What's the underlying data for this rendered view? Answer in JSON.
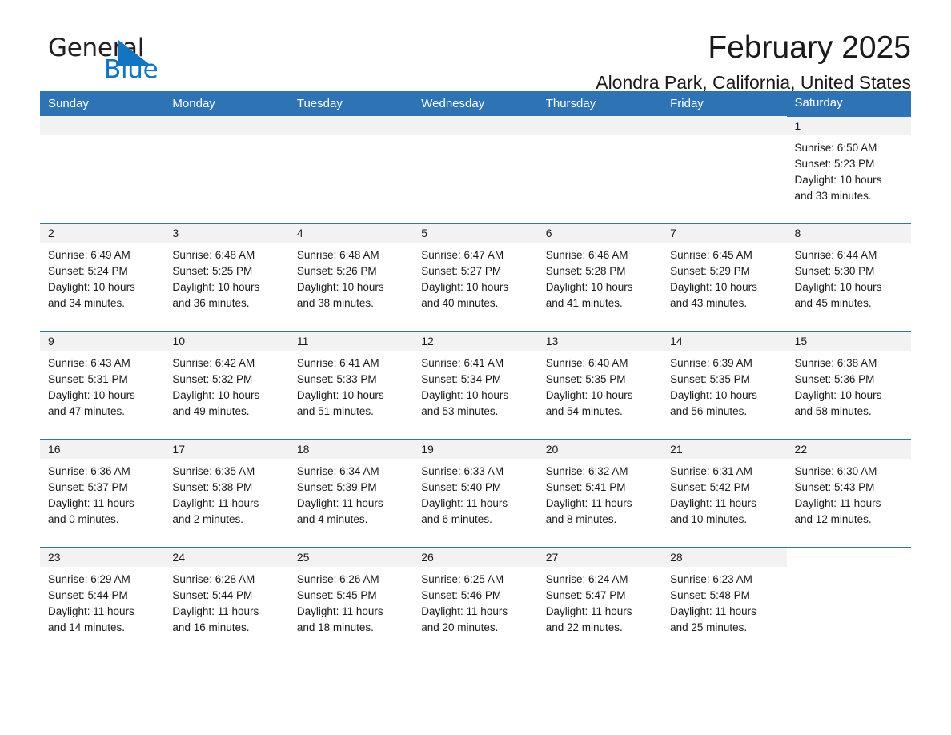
{
  "brand": {
    "name_part1": "General",
    "name_part2": "Blue",
    "logo_icon": "triangle-icon"
  },
  "header": {
    "month_title": "February 2025",
    "location": "Alondra Park, California, United States"
  },
  "calendar": {
    "weekday_headers": [
      "Sunday",
      "Monday",
      "Tuesday",
      "Wednesday",
      "Thursday",
      "Friday",
      "Saturday"
    ],
    "weeks": [
      [
        {
          "day": "",
          "sunrise": "",
          "sunset": "",
          "daylight": "",
          "daylight2": "",
          "empty": true
        },
        {
          "day": "",
          "sunrise": "",
          "sunset": "",
          "daylight": "",
          "daylight2": "",
          "empty": true
        },
        {
          "day": "",
          "sunrise": "",
          "sunset": "",
          "daylight": "",
          "daylight2": "",
          "empty": true
        },
        {
          "day": "",
          "sunrise": "",
          "sunset": "",
          "daylight": "",
          "daylight2": "",
          "empty": true
        },
        {
          "day": "",
          "sunrise": "",
          "sunset": "",
          "daylight": "",
          "daylight2": "",
          "empty": true
        },
        {
          "day": "",
          "sunrise": "",
          "sunset": "",
          "daylight": "",
          "daylight2": "",
          "empty": true
        },
        {
          "day": "1",
          "sunrise": "Sunrise: 6:50 AM",
          "sunset": "Sunset: 5:23 PM",
          "daylight": "Daylight: 10 hours",
          "daylight2": "and 33 minutes."
        }
      ],
      [
        {
          "day": "2",
          "sunrise": "Sunrise: 6:49 AM",
          "sunset": "Sunset: 5:24 PM",
          "daylight": "Daylight: 10 hours",
          "daylight2": "and 34 minutes."
        },
        {
          "day": "3",
          "sunrise": "Sunrise: 6:48 AM",
          "sunset": "Sunset: 5:25 PM",
          "daylight": "Daylight: 10 hours",
          "daylight2": "and 36 minutes."
        },
        {
          "day": "4",
          "sunrise": "Sunrise: 6:48 AM",
          "sunset": "Sunset: 5:26 PM",
          "daylight": "Daylight: 10 hours",
          "daylight2": "and 38 minutes."
        },
        {
          "day": "5",
          "sunrise": "Sunrise: 6:47 AM",
          "sunset": "Sunset: 5:27 PM",
          "daylight": "Daylight: 10 hours",
          "daylight2": "and 40 minutes."
        },
        {
          "day": "6",
          "sunrise": "Sunrise: 6:46 AM",
          "sunset": "Sunset: 5:28 PM",
          "daylight": "Daylight: 10 hours",
          "daylight2": "and 41 minutes."
        },
        {
          "day": "7",
          "sunrise": "Sunrise: 6:45 AM",
          "sunset": "Sunset: 5:29 PM",
          "daylight": "Daylight: 10 hours",
          "daylight2": "and 43 minutes."
        },
        {
          "day": "8",
          "sunrise": "Sunrise: 6:44 AM",
          "sunset": "Sunset: 5:30 PM",
          "daylight": "Daylight: 10 hours",
          "daylight2": "and 45 minutes."
        }
      ],
      [
        {
          "day": "9",
          "sunrise": "Sunrise: 6:43 AM",
          "sunset": "Sunset: 5:31 PM",
          "daylight": "Daylight: 10 hours",
          "daylight2": "and 47 minutes."
        },
        {
          "day": "10",
          "sunrise": "Sunrise: 6:42 AM",
          "sunset": "Sunset: 5:32 PM",
          "daylight": "Daylight: 10 hours",
          "daylight2": "and 49 minutes."
        },
        {
          "day": "11",
          "sunrise": "Sunrise: 6:41 AM",
          "sunset": "Sunset: 5:33 PM",
          "daylight": "Daylight: 10 hours",
          "daylight2": "and 51 minutes."
        },
        {
          "day": "12",
          "sunrise": "Sunrise: 6:41 AM",
          "sunset": "Sunset: 5:34 PM",
          "daylight": "Daylight: 10 hours",
          "daylight2": "and 53 minutes."
        },
        {
          "day": "13",
          "sunrise": "Sunrise: 6:40 AM",
          "sunset": "Sunset: 5:35 PM",
          "daylight": "Daylight: 10 hours",
          "daylight2": "and 54 minutes."
        },
        {
          "day": "14",
          "sunrise": "Sunrise: 6:39 AM",
          "sunset": "Sunset: 5:35 PM",
          "daylight": "Daylight: 10 hours",
          "daylight2": "and 56 minutes."
        },
        {
          "day": "15",
          "sunrise": "Sunrise: 6:38 AM",
          "sunset": "Sunset: 5:36 PM",
          "daylight": "Daylight: 10 hours",
          "daylight2": "and 58 minutes."
        }
      ],
      [
        {
          "day": "16",
          "sunrise": "Sunrise: 6:36 AM",
          "sunset": "Sunset: 5:37 PM",
          "daylight": "Daylight: 11 hours",
          "daylight2": "and 0 minutes."
        },
        {
          "day": "17",
          "sunrise": "Sunrise: 6:35 AM",
          "sunset": "Sunset: 5:38 PM",
          "daylight": "Daylight: 11 hours",
          "daylight2": "and 2 minutes."
        },
        {
          "day": "18",
          "sunrise": "Sunrise: 6:34 AM",
          "sunset": "Sunset: 5:39 PM",
          "daylight": "Daylight: 11 hours",
          "daylight2": "and 4 minutes."
        },
        {
          "day": "19",
          "sunrise": "Sunrise: 6:33 AM",
          "sunset": "Sunset: 5:40 PM",
          "daylight": "Daylight: 11 hours",
          "daylight2": "and 6 minutes."
        },
        {
          "day": "20",
          "sunrise": "Sunrise: 6:32 AM",
          "sunset": "Sunset: 5:41 PM",
          "daylight": "Daylight: 11 hours",
          "daylight2": "and 8 minutes."
        },
        {
          "day": "21",
          "sunrise": "Sunrise: 6:31 AM",
          "sunset": "Sunset: 5:42 PM",
          "daylight": "Daylight: 11 hours",
          "daylight2": "and 10 minutes."
        },
        {
          "day": "22",
          "sunrise": "Sunrise: 6:30 AM",
          "sunset": "Sunset: 5:43 PM",
          "daylight": "Daylight: 11 hours",
          "daylight2": "and 12 minutes."
        }
      ],
      [
        {
          "day": "23",
          "sunrise": "Sunrise: 6:29 AM",
          "sunset": "Sunset: 5:44 PM",
          "daylight": "Daylight: 11 hours",
          "daylight2": "and 14 minutes."
        },
        {
          "day": "24",
          "sunrise": "Sunrise: 6:28 AM",
          "sunset": "Sunset: 5:44 PM",
          "daylight": "Daylight: 11 hours",
          "daylight2": "and 16 minutes."
        },
        {
          "day": "25",
          "sunrise": "Sunrise: 6:26 AM",
          "sunset": "Sunset: 5:45 PM",
          "daylight": "Daylight: 11 hours",
          "daylight2": "and 18 minutes."
        },
        {
          "day": "26",
          "sunrise": "Sunrise: 6:25 AM",
          "sunset": "Sunset: 5:46 PM",
          "daylight": "Daylight: 11 hours",
          "daylight2": "and 20 minutes."
        },
        {
          "day": "27",
          "sunrise": "Sunrise: 6:24 AM",
          "sunset": "Sunset: 5:47 PM",
          "daylight": "Daylight: 11 hours",
          "daylight2": "and 22 minutes."
        },
        {
          "day": "28",
          "sunrise": "Sunrise: 6:23 AM",
          "sunset": "Sunset: 5:48 PM",
          "daylight": "Daylight: 11 hours",
          "daylight2": "and 25 minutes."
        },
        {
          "day": "",
          "sunrise": "",
          "sunset": "",
          "daylight": "",
          "daylight2": "",
          "blank": true
        }
      ]
    ]
  },
  "colors": {
    "header_blue": "#2e74b5",
    "brand_blue": "#1275c4",
    "daynum_band": "#f2f2f2",
    "text": "#1a1a1a"
  }
}
